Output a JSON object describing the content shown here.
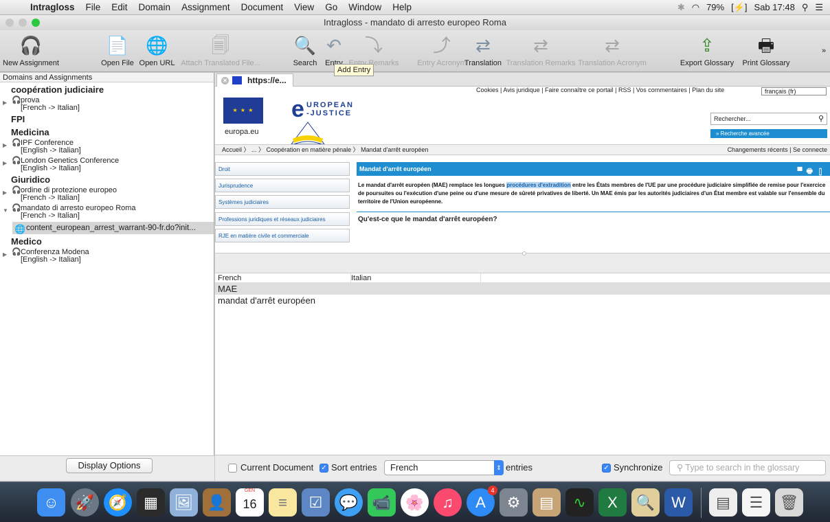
{
  "menubar": {
    "app": "Intragloss",
    "items": [
      "File",
      "Edit",
      "Domain",
      "Assignment",
      "Document",
      "View",
      "Go",
      "Window",
      "Help"
    ],
    "battery": "79%",
    "clock": "Sab 17:48"
  },
  "window": {
    "title": "Intragloss - mandato di arresto europeo Roma"
  },
  "toolbar": {
    "new_assignment": "New Assignment",
    "open_file": "Open File",
    "open_url": "Open URL",
    "attach": "Attach Translated File...",
    "search": "Search",
    "entry": "Entry",
    "entry_remarks": "Entry Remarks",
    "entry_acronym": "Entry Acronym",
    "translation": "Translation",
    "translation_remarks": "Translation Remarks",
    "translation_acronym": "Translation Acronym",
    "export": "Export Glossary",
    "print": "Print Glossary",
    "more": "»",
    "tooltip": "Add Entry"
  },
  "sidebar": {
    "header": "Domains and Assignments",
    "groups": [
      {
        "name": "coopération judiciaire"
      },
      {
        "name": "FPI"
      },
      {
        "name": "Medicina"
      },
      {
        "name": "Giuridico"
      },
      {
        "name": "Medico"
      }
    ],
    "items": [
      {
        "name": "prova",
        "lang": "[French -> Italian]"
      },
      {
        "name": "IPF Conference",
        "lang": "[English -> Italian]"
      },
      {
        "name": "London Genetics Conference",
        "lang": "[English -> Italian]"
      },
      {
        "name": "ordine di protezione europeo",
        "lang": "[French -> Italian]"
      },
      {
        "name": "mandato di arresto europeo Roma",
        "lang": "[French -> Italian]"
      },
      {
        "name": "Conferenza Modena",
        "lang": "[English -> Italian]"
      }
    ],
    "selected_doc": "content_european_arrest_warrant-90-fr.do?init...",
    "display_options": "Display Options"
  },
  "browser": {
    "tab_label": "https://e...",
    "toplinks": "Cookies | Avis juridique | Faire connaître ce portail | RSS | Vos commentaires | Plan du site",
    "language": "français (fr)",
    "europa": "europa.eu",
    "logo_line1": "UROPEAN",
    "logo_line2": "-JUSTICE",
    "search_placeholder": "Rechercher...",
    "advanced": "» Recherche avancée",
    "crumbs": "Accueil  〉 ...  〉 Coopération en matière pénale  〉 Mandat d'arrêt européen",
    "crumbs_right": "Changements récents  |  Se connecte",
    "nav": [
      "Droit",
      "Jurisprudence",
      "Systèmes judiciaires",
      "Professions juridiques et réseaux judiciaires",
      "RJE en matière civile et commerciale"
    ],
    "heading": "Mandat d'arrêt européen",
    "para_a": "Le mandat d'arrêt européen (MAE) remplace les longues ",
    "para_hl": "procédures d'extradition",
    "para_b": " entre les États membres de l'UE par une procédure judiciaire simplifiée de remise pour l'exercice de poursuites ou l'exécution d'une peine ou d'une mesure de sûreté privatives de liberté. Un MAE émis par les autorités judiciaires d'un État membre est valable sur l'ensemble du territoire de l'Union européenne.",
    "question": "Qu'est-ce que le mandat d'arrêt européen?"
  },
  "glossary": {
    "col_source": "French",
    "col_target": "Italian",
    "rows": [
      "MAE",
      "mandat d'arrêt européen"
    ]
  },
  "bottom": {
    "current_document": "Current Document",
    "sort_entries": "Sort entries",
    "sort_lang": "French",
    "entries": "entries",
    "synchronize": "Synchronize",
    "search_placeholder": "Type to search in the glossary"
  },
  "dock": {
    "calendar_month": "GEN",
    "calendar_day": "16",
    "appstore_badge": "4"
  }
}
